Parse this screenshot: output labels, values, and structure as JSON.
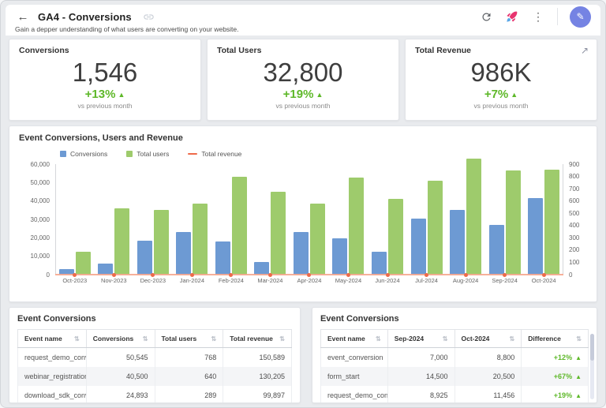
{
  "header": {
    "title": "GA4 - Conversions",
    "subtitle": "Gain a depper understanding of what users are converting on your website."
  },
  "icons": {
    "back": "←",
    "more": "⋮",
    "pencil": "✎",
    "maximize": "↗",
    "sort": "⇅",
    "triangle_up": "▲"
  },
  "colors": {
    "accent_green": "#5eb829",
    "bar_blue": "#6d9ad3",
    "bar_green": "#9ecb6c",
    "line_orange": "#ee6a4a",
    "edit_button": "#7583e3",
    "rocket_pink": "#e8346f"
  },
  "kpis": [
    {
      "title": "Conversions",
      "value": "1,546",
      "delta": "+13%",
      "caption": "vs previous month"
    },
    {
      "title": "Total Users",
      "value": "32,800",
      "delta": "+19%",
      "caption": "vs previous month"
    },
    {
      "title": "Total Revenue",
      "value": "986K",
      "delta": "+7%",
      "caption": "vs previous month"
    }
  ],
  "chart_data": {
    "type": "bar",
    "title": "Event Conversions, Users and Revenue",
    "legend_position": "top-left",
    "grid": false,
    "categories": [
      "Oct-2023",
      "Nov-2023",
      "Dec-2023",
      "Jan-2024",
      "Feb-2024",
      "Mar-2024",
      "Apr-2024",
      "May-2024",
      "Jun-2024",
      "Jul-2024",
      "Aug-2024",
      "Sep-2024",
      "Oct-2024"
    ],
    "series": [
      {
        "name": "Conversions",
        "type": "bar",
        "axis": "left",
        "color": "#6d9ad3",
        "values": [
          3000,
          5800,
          18500,
          23000,
          18000,
          6700,
          23000,
          19500,
          12500,
          30500,
          35200,
          27000,
          41500
        ]
      },
      {
        "name": "Total users",
        "type": "bar",
        "axis": "left",
        "color": "#9ecb6c",
        "values": [
          12500,
          36000,
          35000,
          38500,
          53000,
          45000,
          38500,
          52800,
          41000,
          51000,
          63000,
          56500,
          57000
        ]
      },
      {
        "name": "Total revenue",
        "type": "line",
        "axis": "right",
        "color": "#ee6a4a",
        "values": [
          5,
          5,
          5,
          5,
          5,
          5,
          5,
          5,
          5,
          5,
          5,
          5,
          5
        ]
      }
    ],
    "left_axis": {
      "min": 0,
      "max": 60000,
      "labels": [
        "0",
        "10,000",
        "20,000",
        "30,000",
        "40,000",
        "50,000",
        "60,000"
      ]
    },
    "right_axis": {
      "min": 0,
      "max": 900,
      "labels": [
        "0",
        "100",
        "200",
        "300",
        "400",
        "500",
        "600",
        "700",
        "800",
        "900"
      ]
    }
  },
  "tables": {
    "left": {
      "title": "Event Conversions",
      "columns": [
        "Event name",
        "Conversions",
        "Total users",
        "Total revenue"
      ],
      "rows": [
        [
          "request_demo_conversi...",
          "50,545",
          "768",
          "150,589"
        ],
        [
          "webinar_registration",
          "40,500",
          "640",
          "130,205"
        ],
        [
          "download_sdk_conversi...",
          "24,893",
          "289",
          "99,897"
        ]
      ]
    },
    "right": {
      "title": "Event Conversions",
      "columns": [
        "Event name",
        "Sep-2024",
        "Oct-2024",
        "Difference"
      ],
      "diff_col": 3,
      "rows": [
        [
          "event_conversion",
          "7,000",
          "8,800",
          "+12%"
        ],
        [
          "form_start",
          "14,500",
          "20,500",
          "+67%"
        ],
        [
          "request_demo_conversi...",
          "8,925",
          "11,456",
          "+19%"
        ]
      ]
    }
  }
}
